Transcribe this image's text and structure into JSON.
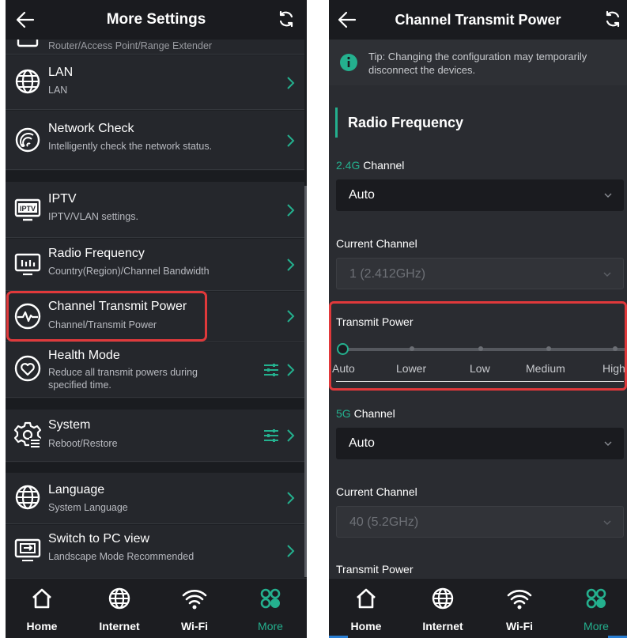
{
  "left_screen": {
    "title": "More Settings",
    "partial_item_sub": "Router/Access Point/Range Extender",
    "items": [
      {
        "label": "LAN",
        "sub": "LAN",
        "icon": "globe-icon"
      },
      {
        "label": "Network Check",
        "sub": "Intelligently check the network status.",
        "icon": "network-check-icon"
      },
      {
        "label": "IPTV",
        "sub": "IPTV/VLAN settings.",
        "icon": "iptv-icon",
        "icon_text": "IPTV"
      },
      {
        "label": "Radio Frequency",
        "sub": "Country(Region)/Channel Bandwidth",
        "icon": "radio-frequency-icon"
      },
      {
        "label": "Channel Transmit Power",
        "sub": "Channel/Transmit Power",
        "icon": "transmit-power-icon"
      },
      {
        "label": "Health Mode",
        "sub": "Reduce all transmit powers during specified time.",
        "icon": "heart-icon"
      },
      {
        "label": "System",
        "sub": "Reboot/Restore",
        "icon": "system-gear-icon"
      },
      {
        "label": "Language",
        "sub": "System Language",
        "icon": "globe-icon"
      },
      {
        "label": "Switch to PC view",
        "sub": "Landscape Mode Recommended",
        "icon": "pc-view-icon"
      }
    ]
  },
  "right_screen": {
    "title": "Channel Transmit Power",
    "tip": "Tip: Changing the configuration may temporarily disconnect the devices.",
    "section": "Radio Frequency",
    "ch24_label_prefix": "2.4G",
    "ch24_label_rest": " Channel",
    "ch24_value": "Auto",
    "current_channel_label": "Current Channel",
    "current_channel_24_value": "1 (2.412GHz)",
    "transmit_power_label": "Transmit Power",
    "power_levels": [
      "Auto",
      "Lower",
      "Low",
      "Medium",
      "High"
    ],
    "power_selected": "Auto",
    "ch5_label_prefix": "5G",
    "ch5_label_rest": " Channel",
    "ch5_value": "Auto",
    "current_channel_5_label": "Current Channel",
    "current_channel_5_value": "40 (5.2GHz)",
    "transmit_power_5_label": "Transmit Power"
  },
  "bottom_nav": {
    "home": "Home",
    "internet": "Internet",
    "wifi": "Wi-Fi",
    "more": "More"
  },
  "colors": {
    "accent": "#24b08e",
    "highlight": "#e0393b",
    "background": "#1e2024"
  }
}
